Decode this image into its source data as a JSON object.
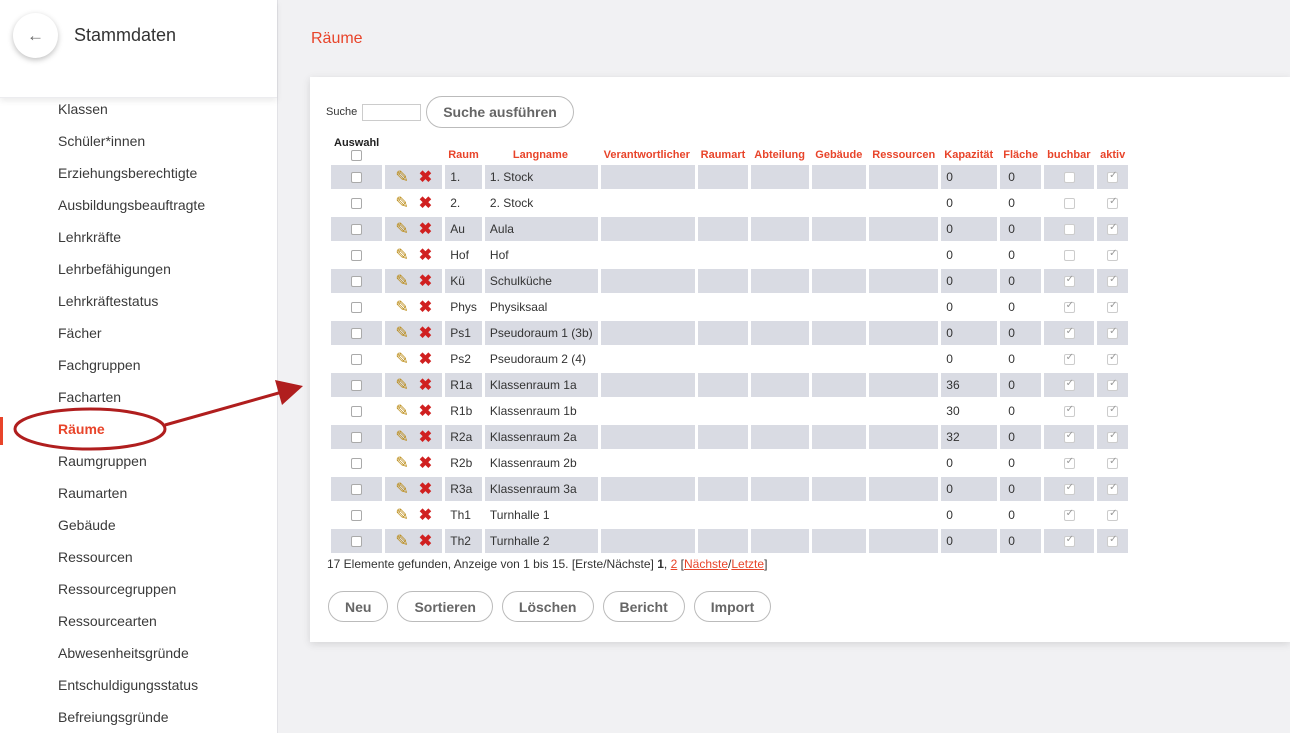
{
  "sidebar": {
    "back_icon": "←",
    "title": "Stammdaten",
    "items": [
      {
        "label": "Klassen"
      },
      {
        "label": "Schüler*innen"
      },
      {
        "label": "Erziehungsberechtigte"
      },
      {
        "label": "Ausbildungsbeauftragte"
      },
      {
        "label": "Lehrkräfte"
      },
      {
        "label": "Lehrbefähigungen"
      },
      {
        "label": "Lehrkräftestatus"
      },
      {
        "label": "Fächer"
      },
      {
        "label": "Fachgruppen"
      },
      {
        "label": "Facharten"
      },
      {
        "label": "Räume",
        "active": true
      },
      {
        "label": "Raumgruppen"
      },
      {
        "label": "Raumarten"
      },
      {
        "label": "Gebäude"
      },
      {
        "label": "Ressourcen"
      },
      {
        "label": "Ressourcegruppen"
      },
      {
        "label": "Ressourcearten"
      },
      {
        "label": "Abwesenheitsgründe"
      },
      {
        "label": "Entschuldigungsstatus"
      },
      {
        "label": "Befreiungsgründe"
      }
    ]
  },
  "main": {
    "title": "Räume",
    "search_label": "Suche",
    "search_value": "",
    "search_button": "Suche ausführen",
    "columns": {
      "auswahl": "Auswahl",
      "raum": "Raum",
      "langname": "Langname",
      "verantwortlicher": "Verantwortlicher",
      "raumart": "Raumart",
      "abteilung": "Abteilung",
      "gebaeude": "Gebäude",
      "ressourcen": "Ressourcen",
      "kapazitaet": "Kapazität",
      "flaeche": "Fläche",
      "buchbar": "buchbar",
      "aktiv": "aktiv"
    },
    "rows": [
      {
        "raum": "1.",
        "langname": "1. Stock",
        "kapazitaet": "0",
        "flaeche": "0",
        "buchbar": false,
        "aktiv": true
      },
      {
        "raum": "2.",
        "langname": "2. Stock",
        "kapazitaet": "0",
        "flaeche": "0",
        "buchbar": false,
        "aktiv": true
      },
      {
        "raum": "Au",
        "langname": "Aula",
        "kapazitaet": "0",
        "flaeche": "0",
        "buchbar": false,
        "aktiv": true
      },
      {
        "raum": "Hof",
        "langname": "Hof",
        "kapazitaet": "0",
        "flaeche": "0",
        "buchbar": false,
        "aktiv": true
      },
      {
        "raum": "Kü",
        "langname": "Schulküche",
        "kapazitaet": "0",
        "flaeche": "0",
        "buchbar": true,
        "aktiv": true
      },
      {
        "raum": "Phys",
        "langname": "Physiksaal",
        "kapazitaet": "0",
        "flaeche": "0",
        "buchbar": true,
        "aktiv": true
      },
      {
        "raum": "Ps1",
        "langname": "Pseudoraum 1 (3b)",
        "kapazitaet": "0",
        "flaeche": "0",
        "buchbar": true,
        "aktiv": true
      },
      {
        "raum": "Ps2",
        "langname": "Pseudoraum 2 (4)",
        "kapazitaet": "0",
        "flaeche": "0",
        "buchbar": true,
        "aktiv": true
      },
      {
        "raum": "R1a",
        "langname": "Klassenraum 1a",
        "kapazitaet": "36",
        "flaeche": "0",
        "buchbar": true,
        "aktiv": true
      },
      {
        "raum": "R1b",
        "langname": "Klassenraum 1b",
        "kapazitaet": "30",
        "flaeche": "0",
        "buchbar": true,
        "aktiv": true
      },
      {
        "raum": "R2a",
        "langname": "Klassenraum 2a",
        "kapazitaet": "32",
        "flaeche": "0",
        "buchbar": true,
        "aktiv": true
      },
      {
        "raum": "R2b",
        "langname": "Klassenraum 2b",
        "kapazitaet": "0",
        "flaeche": "0",
        "buchbar": true,
        "aktiv": true
      },
      {
        "raum": "R3a",
        "langname": "Klassenraum 3a",
        "kapazitaet": "0",
        "flaeche": "0",
        "buchbar": true,
        "aktiv": true
      },
      {
        "raum": "Th1",
        "langname": "Turnhalle 1",
        "kapazitaet": "0",
        "flaeche": "0",
        "buchbar": true,
        "aktiv": true
      },
      {
        "raum": "Th2",
        "langname": "Turnhalle 2",
        "kapazitaet": "0",
        "flaeche": "0",
        "buchbar": true,
        "aktiv": true
      }
    ],
    "pager": {
      "info": "17 Elemente gefunden, Anzeige von 1 bis 15. [Erste/Nächste]",
      "current_page": "1",
      "page2": "2",
      "next": "Nächste",
      "last": "Letzte"
    },
    "buttons": {
      "neu": "Neu",
      "sortieren": "Sortieren",
      "loeschen": "Löschen",
      "bericht": "Bericht",
      "import": "Import"
    }
  },
  "icons": {
    "edit": "pencil-icon",
    "delete": "delete-x-icon"
  },
  "colors": {
    "accent": "#e8442a",
    "annotation": "#b01e1e",
    "row_alt": "#d9dbe3"
  }
}
